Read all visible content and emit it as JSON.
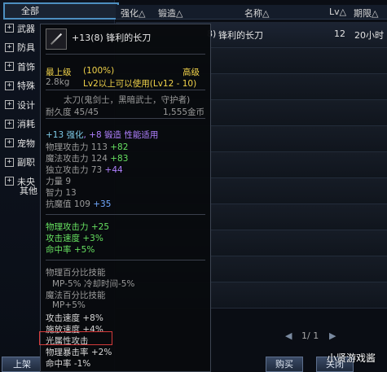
{
  "sidebar": {
    "all_label": "全部",
    "items": [
      "武器",
      "防具",
      "首饰",
      "特殊",
      "设计",
      "消耗",
      "宠物",
      "副职",
      "未央"
    ],
    "other_label": "其他",
    "list_button": "上架"
  },
  "table": {
    "headers": {
      "enhance": "强化△",
      "forge": "锻造△",
      "name": "名称△",
      "level": "Lv△",
      "expire": "期限△"
    },
    "first_row": {
      "name": "锋利的长刀",
      "name_prefix": "8)",
      "level": "12",
      "expire": "20小时"
    }
  },
  "pager": {
    "prev": "◀",
    "text": "1/ 1",
    "next": "▶"
  },
  "buttons": {
    "buy": "购买",
    "close": "关闭"
  },
  "watermark": "小贤游戏酱",
  "tooltip": {
    "title": "+13(8) 锋利的长刀",
    "grade": "最上级",
    "grade_pct": "(100%)",
    "rarity": "高级",
    "weight": "2.8kg",
    "usable": "Lv2以上可以使用(Lv12 - 10)",
    "type": "太刀(鬼剑士，黑暗武士，守护者)",
    "durability": "耐久度 45/45",
    "price": "1,555金币",
    "enhance_note_a": "+13 强化",
    "enhance_note_b": ", +8 锻造 性能适用",
    "stats": [
      {
        "label": "物理攻击力 113",
        "bonus": "+82",
        "color": "green"
      },
      {
        "label": "魔法攻击力 124",
        "bonus": "+83",
        "color": "green"
      },
      {
        "label": "独立攻击力 73",
        "bonus": "+44",
        "color": "purple"
      },
      {
        "label": "力量 9",
        "bonus": "",
        "color": "green"
      },
      {
        "label": "智力 13",
        "bonus": "",
        "color": "green"
      },
      {
        "label": "抗魔值 109",
        "bonus": "+35",
        "color": "blue"
      }
    ],
    "effects": [
      {
        "label": "物理攻击力",
        "bonus": "+25"
      },
      {
        "label": "攻击速度",
        "bonus": "+3%"
      },
      {
        "label": "命中率",
        "bonus": "+5%"
      }
    ],
    "skills": [
      {
        "text": "物理百分比技能",
        "cls": "gray"
      },
      {
        "text": "MP-5% 冷却时间-5%",
        "cls": "gray"
      },
      {
        "text": "魔法百分比技能",
        "cls": "gray"
      },
      {
        "text": "MP+5%",
        "cls": "gray"
      },
      {
        "text": "攻击速度 +8%",
        "cls": "white"
      },
      {
        "text": "施放速度 +4%",
        "cls": "white"
      },
      {
        "text": "光属性攻击",
        "cls": "white"
      },
      {
        "text": "物理暴击率 +2%",
        "cls": "white"
      },
      {
        "text": "命中率 -1%",
        "cls": "white"
      }
    ]
  }
}
